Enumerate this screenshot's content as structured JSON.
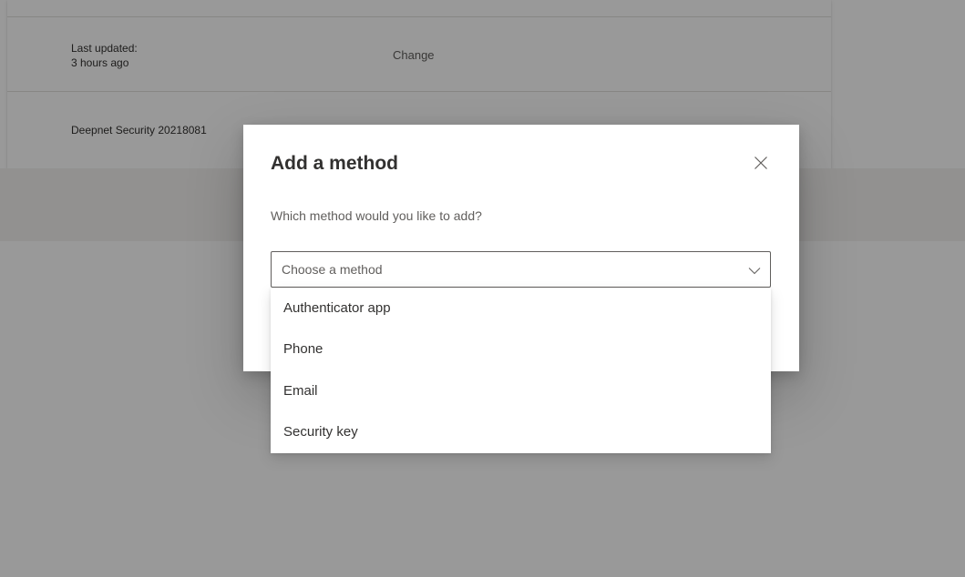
{
  "background": {
    "rows": [
      {
        "label_line1": "Last updated:",
        "label_line2": "3 hours ago",
        "action": "Change"
      },
      {
        "label": "Deepnet Security 20218081"
      }
    ]
  },
  "dialog": {
    "title": "Add a method",
    "question": "Which method would you like to add?",
    "close_icon": "close-icon",
    "select": {
      "placeholder": "Choose a method",
      "chevron_icon": "chevron-down-icon",
      "expanded": true,
      "options": [
        "Authenticator app",
        "Phone",
        "Email",
        "Security key"
      ]
    }
  },
  "colors": {
    "overlay": "#000000",
    "dialog_bg": "#ffffff",
    "text_primary": "#323130",
    "text_secondary": "#605e5c",
    "border": "#605e5c"
  }
}
